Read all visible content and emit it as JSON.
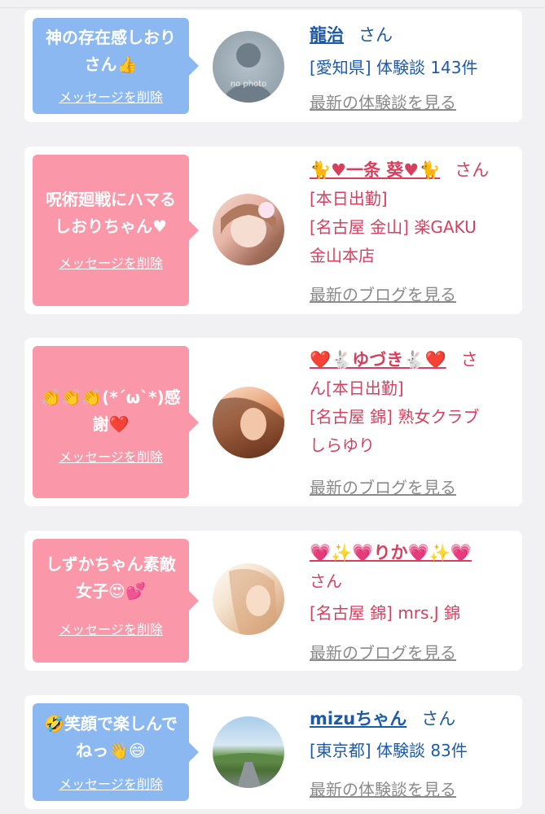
{
  "items": [
    {
      "message": "神の存在感しおりさん👍",
      "delete_label": "メッセージを削除",
      "name": "龍治",
      "honorific": "さん",
      "lines": [
        "[愛知県] 体験談 143件"
      ],
      "latest_link": "最新の体験談を見る",
      "theme": "blue",
      "avatar_text": "no photo"
    },
    {
      "message": "呪術廻戦にハマるしおりちゃん♥",
      "delete_label": "メッセージを削除",
      "name": "🐈♥一条 葵♥🐈",
      "honorific": "さん",
      "lines": [
        "[本日出勤]",
        "[名古屋 金山] 楽GAKU",
        "金山本店"
      ],
      "latest_link": "最新のブログを見る",
      "theme": "pink"
    },
    {
      "message": "👏👏👏(*´ω`*)感謝❤️",
      "delete_label": "メッセージを削除",
      "name": "❤️🐇ゆづき🐇❤️",
      "honorific": "さ",
      "lines": [
        "ん[本日出勤]",
        "[名古屋 錦] 熟女クラブ",
        "しらゆり"
      ],
      "latest_link": "最新のブログを見る",
      "theme": "pink"
    },
    {
      "message": "しずかちゃん素敵女子😍💕",
      "delete_label": "メッセージを削除",
      "name": "💗✨💗りか💗✨💗",
      "honorific": "",
      "lines": [
        "さん",
        "[名古屋 錦] mrs.J 錦"
      ],
      "latest_link": "最新のブログを見る",
      "theme": "pink"
    },
    {
      "message": "🤣笑顔で楽しんでねっ👋😄",
      "delete_label": "メッセージを削除",
      "name": "mizuちゃん",
      "honorific": "さん",
      "lines": [
        "[東京都] 体験談 83件"
      ],
      "latest_link": "最新の体験談を見る",
      "theme": "blue"
    }
  ]
}
